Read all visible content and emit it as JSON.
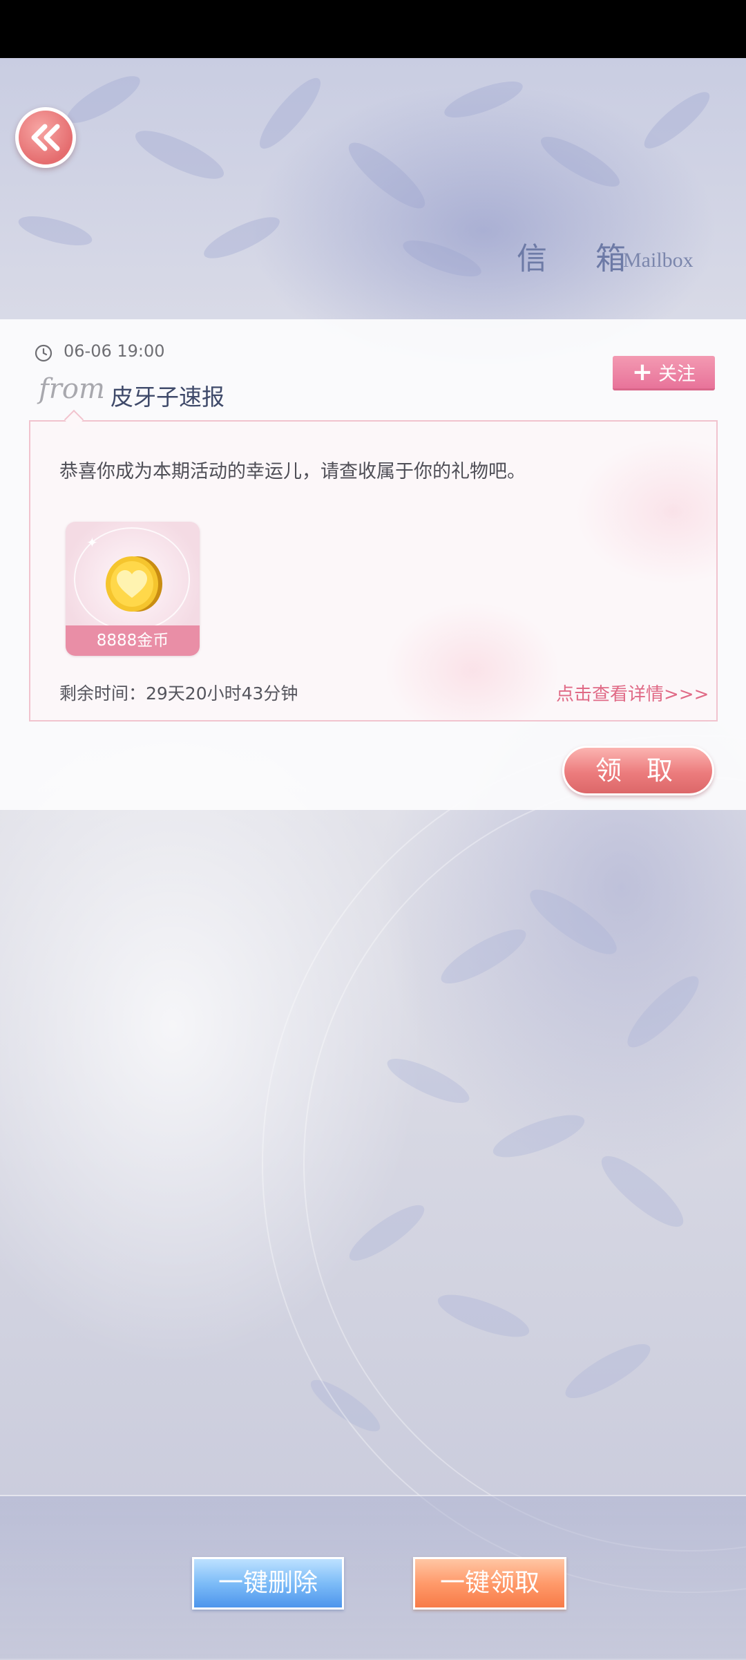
{
  "header": {
    "title": "信 箱",
    "subtitle": "Mailbox",
    "back_icon": "double-chevron-left-icon"
  },
  "mail": {
    "date": "06-06 19:00",
    "from_word": "from",
    "sender": "皮牙子速报",
    "follow_label": "关注",
    "message": "恭喜你成为本期活动的幸运儿，请查收属于你的礼物吧。",
    "reward": {
      "icon": "gold-heart-coin-icon",
      "label": "8888金币"
    },
    "remaining_time": "剩余时间：29天20小时43分钟",
    "details_link": "点击查看详情>>>",
    "claim_label": "领 取"
  },
  "footer": {
    "delete_all_label": "一键删除",
    "claim_all_label": "一键领取"
  },
  "colors": {
    "accent_pink": "#e8739a",
    "claim_red": "#ec7c7d",
    "delete_blue": "#7dbcf7",
    "claim_all_orange": "#ff9a6b",
    "title_blue": "#6d7aa6"
  }
}
